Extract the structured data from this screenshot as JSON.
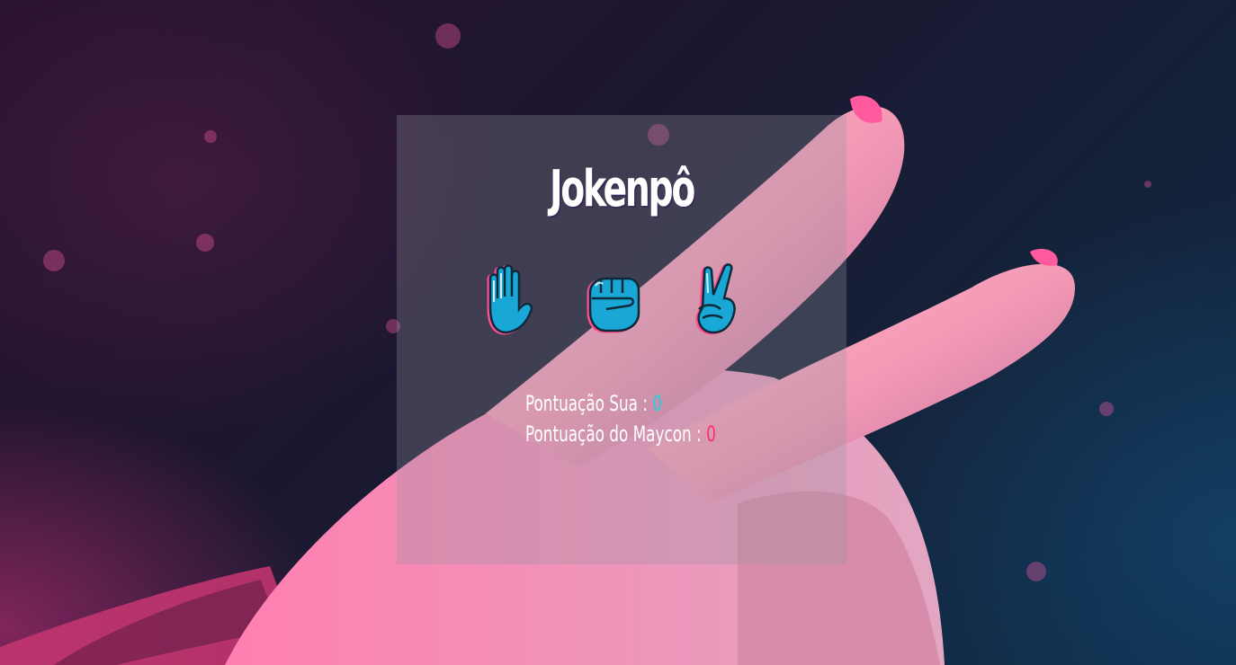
{
  "app": {
    "title": "Jokenpô"
  },
  "moves": [
    {
      "name": "paper",
      "icon": "raised-hand-icon",
      "color": "#19a7d6",
      "outline": "#ff4f8f"
    },
    {
      "name": "rock",
      "icon": "fist-icon",
      "color": "#19a7d6",
      "outline": "#ff4f8f"
    },
    {
      "name": "scissors",
      "icon": "victory-hand-icon",
      "color": "#19a7d6",
      "outline": "#ff4f8f"
    }
  ],
  "scores": {
    "you_label": "Pontuação Sua :",
    "you_value": "0",
    "cpu_label": "Pontuação do Maycon :",
    "cpu_value": "0"
  },
  "colors": {
    "accent_you": "#1fd0e8",
    "accent_cpu": "#ff2a73",
    "panel": "rgba(150,150,160,0.30)"
  }
}
